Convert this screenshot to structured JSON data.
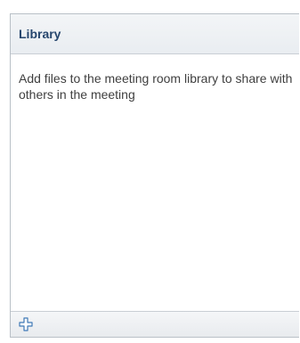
{
  "library": {
    "title": "Library",
    "empty_message": "Add files to the meeting room library to share with others in the meeting"
  },
  "footer": {
    "add_icon": "plus-icon"
  },
  "colors": {
    "title": "#26466d",
    "text": "#3f3f3f",
    "border": "#b9c0c7",
    "icon": "#3f79b6"
  }
}
